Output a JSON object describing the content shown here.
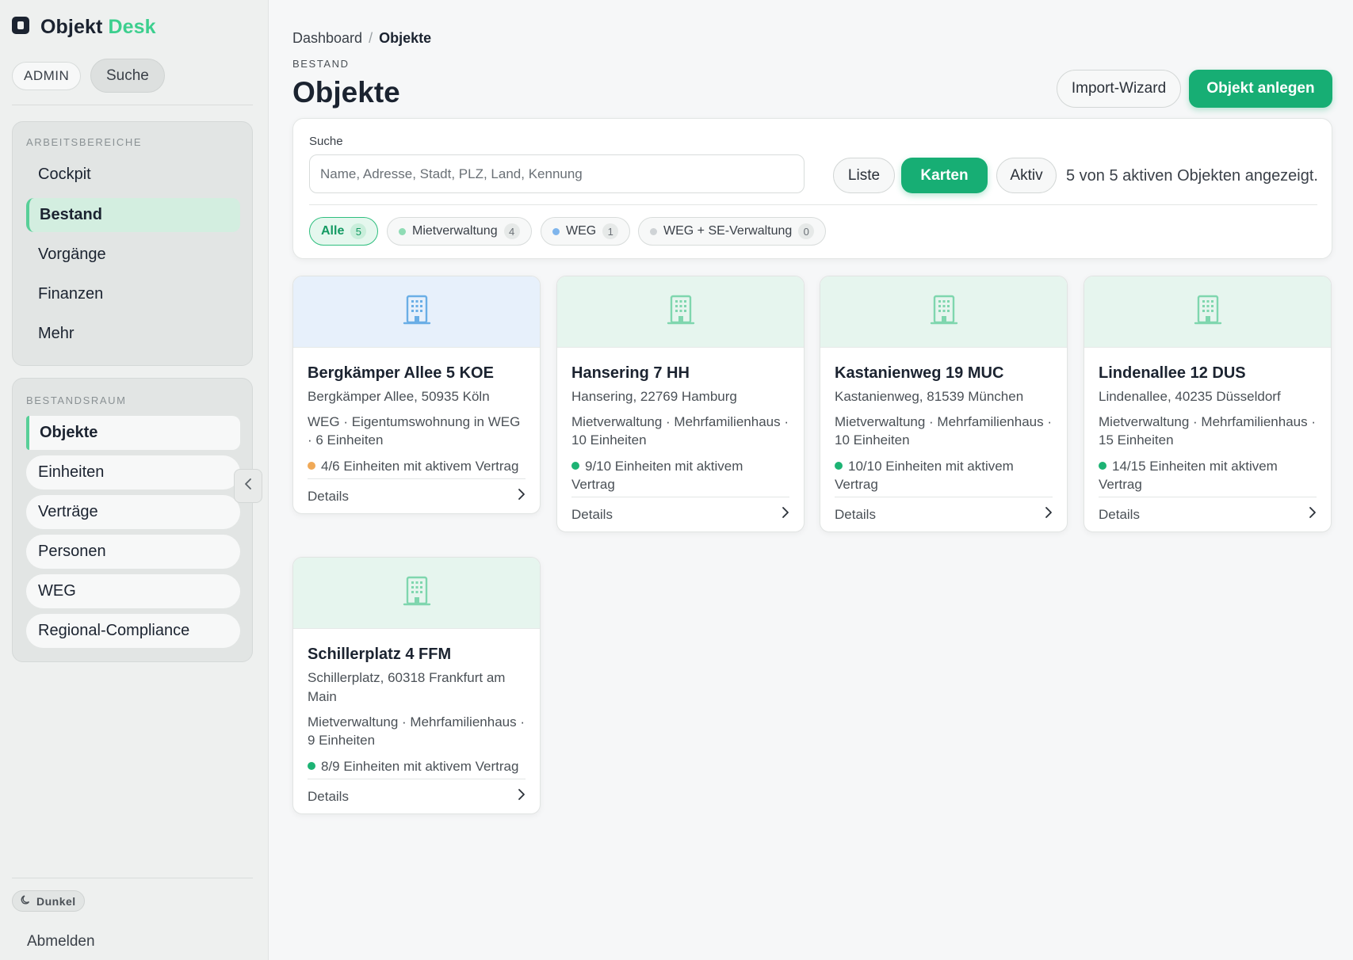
{
  "app": {
    "brand_main": "Objekt",
    "brand_accent": "Desk"
  },
  "header_pills": {
    "admin": "ADMIN",
    "search": "Suche"
  },
  "sidebar": {
    "workspaces_title": "ARBEITSBEREICHE",
    "workspaces": [
      {
        "label": "Cockpit"
      },
      {
        "label": "Bestand"
      },
      {
        "label": "Vorgänge"
      },
      {
        "label": "Finanzen"
      },
      {
        "label": "Mehr"
      }
    ],
    "inventory_title": "BESTANDSRAUM",
    "inventory": [
      {
        "label": "Objekte"
      },
      {
        "label": "Einheiten"
      },
      {
        "label": "Verträge"
      },
      {
        "label": "Personen"
      },
      {
        "label": "WEG"
      },
      {
        "label": "Regional-Compliance"
      }
    ],
    "dark_toggle": "Dunkel",
    "logout": "Abmelden"
  },
  "breadcrumb": {
    "root": "Dashboard",
    "sep": "/",
    "current": "Objekte"
  },
  "page": {
    "kicker": "BESTAND",
    "title": "Objekte",
    "import_btn": "Import-Wizard",
    "create_btn": "Objekt anlegen"
  },
  "search": {
    "label": "Suche",
    "placeholder": "Name, Adresse, Stadt, PLZ, Land, Kennung",
    "value": "",
    "view_list": "Liste",
    "view_cards": "Karten",
    "status_filter": "Aktiv",
    "count_text": "5 von 5 aktiven Objekten angezeigt."
  },
  "filters": [
    {
      "label": "Alle",
      "count": "5"
    },
    {
      "label": "Mietverwaltung",
      "count": "4",
      "dot": "#8fdcb5"
    },
    {
      "label": "WEG",
      "count": "1",
      "dot": "#7fb5ec"
    },
    {
      "label": "WEG + SE-Verwaltung",
      "count": "0",
      "dot": "#cfd3d6"
    }
  ],
  "cards": [
    {
      "title": "Bergkämper Allee 5 KOE",
      "address": "Bergkämper Allee, 50935 Köln",
      "meta": "WEG · Eigentumswohnung in WEG · 6 Einheiten",
      "status": "4/6 Einheiten mit aktivem Vertrag",
      "status_color": "#f0a957",
      "details": "Details",
      "theme": "blue"
    },
    {
      "title": "Hansering 7 HH",
      "address": "Hansering, 22769 Hamburg",
      "meta": "Mietverwaltung · Mehrfamilienhaus · 10 Einheiten",
      "status": "9/10 Einheiten mit aktivem Vertrag",
      "status_color": "#1db374",
      "details": "Details",
      "theme": "green"
    },
    {
      "title": "Kastanienweg 19 MUC",
      "address": "Kastanienweg, 81539 München",
      "meta": "Mietverwaltung · Mehrfamilienhaus · 10 Einheiten",
      "status": "10/10 Einheiten mit aktivem Vertrag",
      "status_color": "#1db374",
      "details": "Details",
      "theme": "green"
    },
    {
      "title": "Lindenallee 12 DUS",
      "address": "Lindenallee, 40235 Düsseldorf",
      "meta": "Mietverwaltung · Mehrfamilienhaus · 15 Einheiten",
      "status": "14/15 Einheiten mit aktivem Vertrag",
      "status_color": "#1db374",
      "details": "Details",
      "theme": "green"
    },
    {
      "title": "Schillerplatz 4 FFM",
      "address": "Schillerplatz, 60318 Frankfurt am Main",
      "meta": "Mietverwaltung · Mehrfamilienhaus · 9 Einheiten",
      "status": "8/9 Einheiten mit aktivem Vertrag",
      "status_color": "#1db374",
      "details": "Details",
      "theme": "green"
    }
  ],
  "colors": {
    "accent": "#17ae74",
    "building_blue": "#6aaee6",
    "building_green": "#7fd6ae"
  },
  "icons": {
    "brand": "objektdesk-logo",
    "building": "building-icon",
    "moon": "moon-icon",
    "chevron_left": "chevron-left-icon",
    "chevron_right": "chevron-right-icon"
  }
}
